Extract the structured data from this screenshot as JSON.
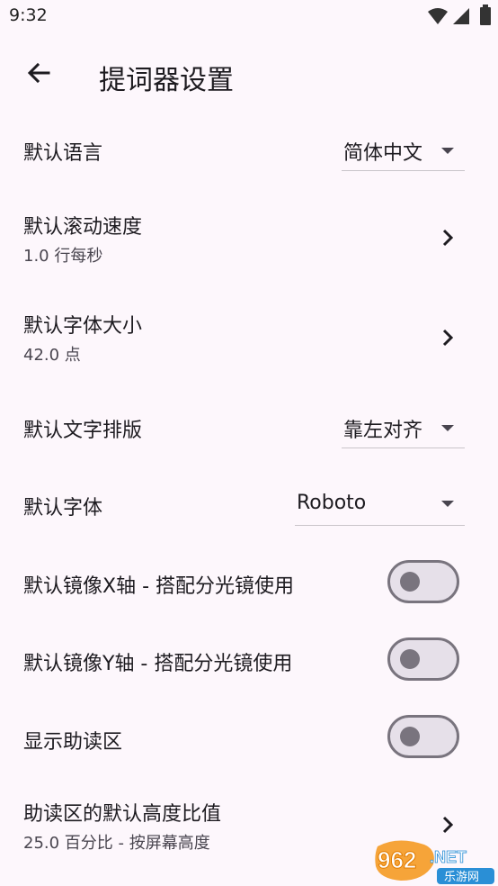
{
  "status_bar": {
    "time": "9:32"
  },
  "app_bar": {
    "title": "提词器设置"
  },
  "settings": {
    "language": {
      "label": "默认语言",
      "value": "简体中文"
    },
    "scroll_speed": {
      "label": "默认滚动速度",
      "value": "1.0 行每秒"
    },
    "font_size": {
      "label": "默认字体大小",
      "value": "42.0 点"
    },
    "text_align": {
      "label": "默认文字排版",
      "value": "靠左对齐"
    },
    "font": {
      "label": "默认字体",
      "value": "Roboto"
    },
    "mirror_x": {
      "label": "默认镜像X轴 - 搭配分光镜使用",
      "on": false
    },
    "mirror_y": {
      "label": "默认镜像Y轴 - 搭配分光镜使用",
      "on": false
    },
    "reading_zone": {
      "label": "显示助读区",
      "on": false
    },
    "reading_zone_height": {
      "label": "助读区的默认高度比值",
      "value": "25.0 百分比 - 按屏幕高度"
    }
  },
  "watermark": {
    "text": "962.NET",
    "subtext": "乐游网"
  },
  "colors": {
    "background": "#fdf7fc",
    "switch_track": "#e6e0e9",
    "switch_outline": "#79747e"
  },
  "icons": [
    "back-arrow-icon",
    "wifi-icon",
    "signal-icon",
    "battery-icon",
    "chevron-right-icon",
    "dropdown-arrow-icon"
  ]
}
